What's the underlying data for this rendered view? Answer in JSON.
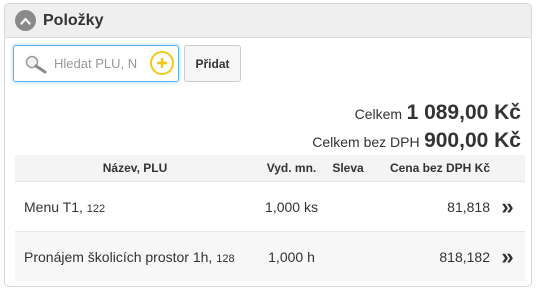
{
  "panel": {
    "title": "Položky",
    "collapse_icon": "chevron-up-icon"
  },
  "search": {
    "placeholder": "Hledat PLU, N",
    "value": "",
    "search_icon": "search-icon",
    "add_icon": "plus-circle-icon",
    "add_button_label": "Přidat"
  },
  "totals": {
    "total_label": "Celkem",
    "total_value": "1 089,00 Kč",
    "total_net_label": "Celkem bez DPH",
    "total_net_value": "900,00 Kč"
  },
  "table": {
    "headers": {
      "name": "Název, PLU",
      "qty": "Vyd. mn.",
      "discount": "Sleva",
      "price": "Cena bez DPH Kč"
    },
    "rows": [
      {
        "name": "Menu T1,",
        "plu": "122",
        "qty": "1,000 ks",
        "discount": "",
        "price": "81,818",
        "action": "»"
      },
      {
        "name": "Pronájem školicích prostor 1h,",
        "plu": "128",
        "qty": "1,000 h",
        "discount": "",
        "price": "818,182",
        "action": "»"
      }
    ]
  },
  "colors": {
    "accent_focus": "#66afe9",
    "add_icon": "#f4c81a",
    "header_bg": "#efefef"
  }
}
